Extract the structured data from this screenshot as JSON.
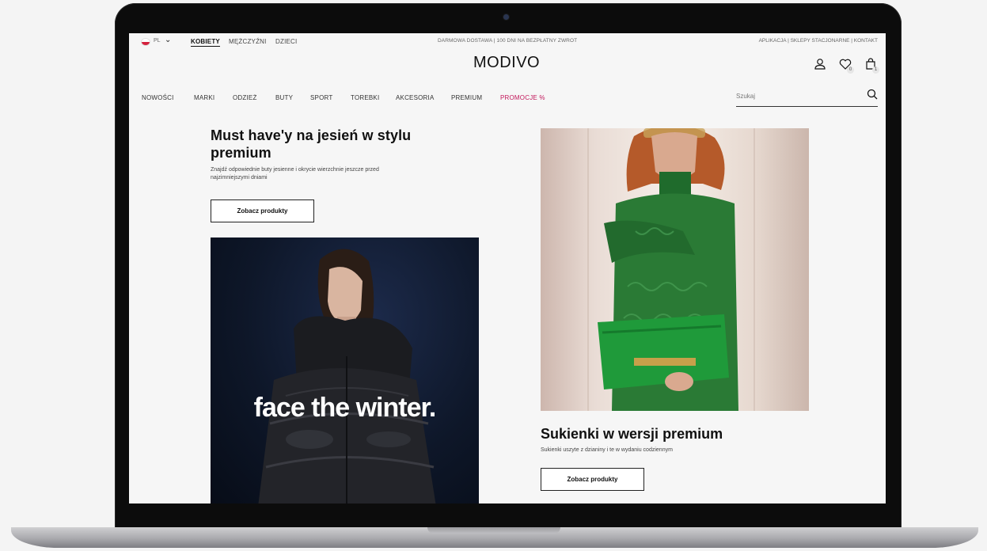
{
  "header": {
    "language": "PL",
    "genders": [
      "KOBIETY",
      "MĘŻCZYŹNI",
      "DZIECI"
    ],
    "promo_text": "DARMOWA DOSTAWA  |  100 DNI NA BEZPŁATNY ZWROT",
    "top_links": "APLIKACJA  |  SKLEPY STACJONARNE  |  KONTAKT",
    "logo": "MODIVO",
    "wishlist_count": "0",
    "cart_count": "1"
  },
  "nav": {
    "items": [
      "NOWOŚCI",
      "MARKI",
      "ODZIEŻ",
      "BUTY",
      "SPORT",
      "TOREBKI",
      "AKCESORIA",
      "PREMIUM",
      "PROMOCJE %"
    ]
  },
  "search": {
    "placeholder": "Szukaj"
  },
  "sections": {
    "left": {
      "title": "Must have'y na jesień w stylu premium",
      "subtitle": "Znajdź odpowiednie buty jesienne i okrycie wierzchnie jeszcze przed najzimniejszymi dniami",
      "cta": "Zobacz produkty",
      "image_text": "face the winter."
    },
    "right": {
      "title": "Sukienki w wersji premium",
      "subtitle": "Sukienki uszyte z dzianiny i te w wydaniu codziennym",
      "cta": "Zobacz produkty"
    }
  },
  "colors": {
    "accent_promo": "#c2185b",
    "text": "#111111",
    "screen_bg": "#f6f6f6"
  }
}
